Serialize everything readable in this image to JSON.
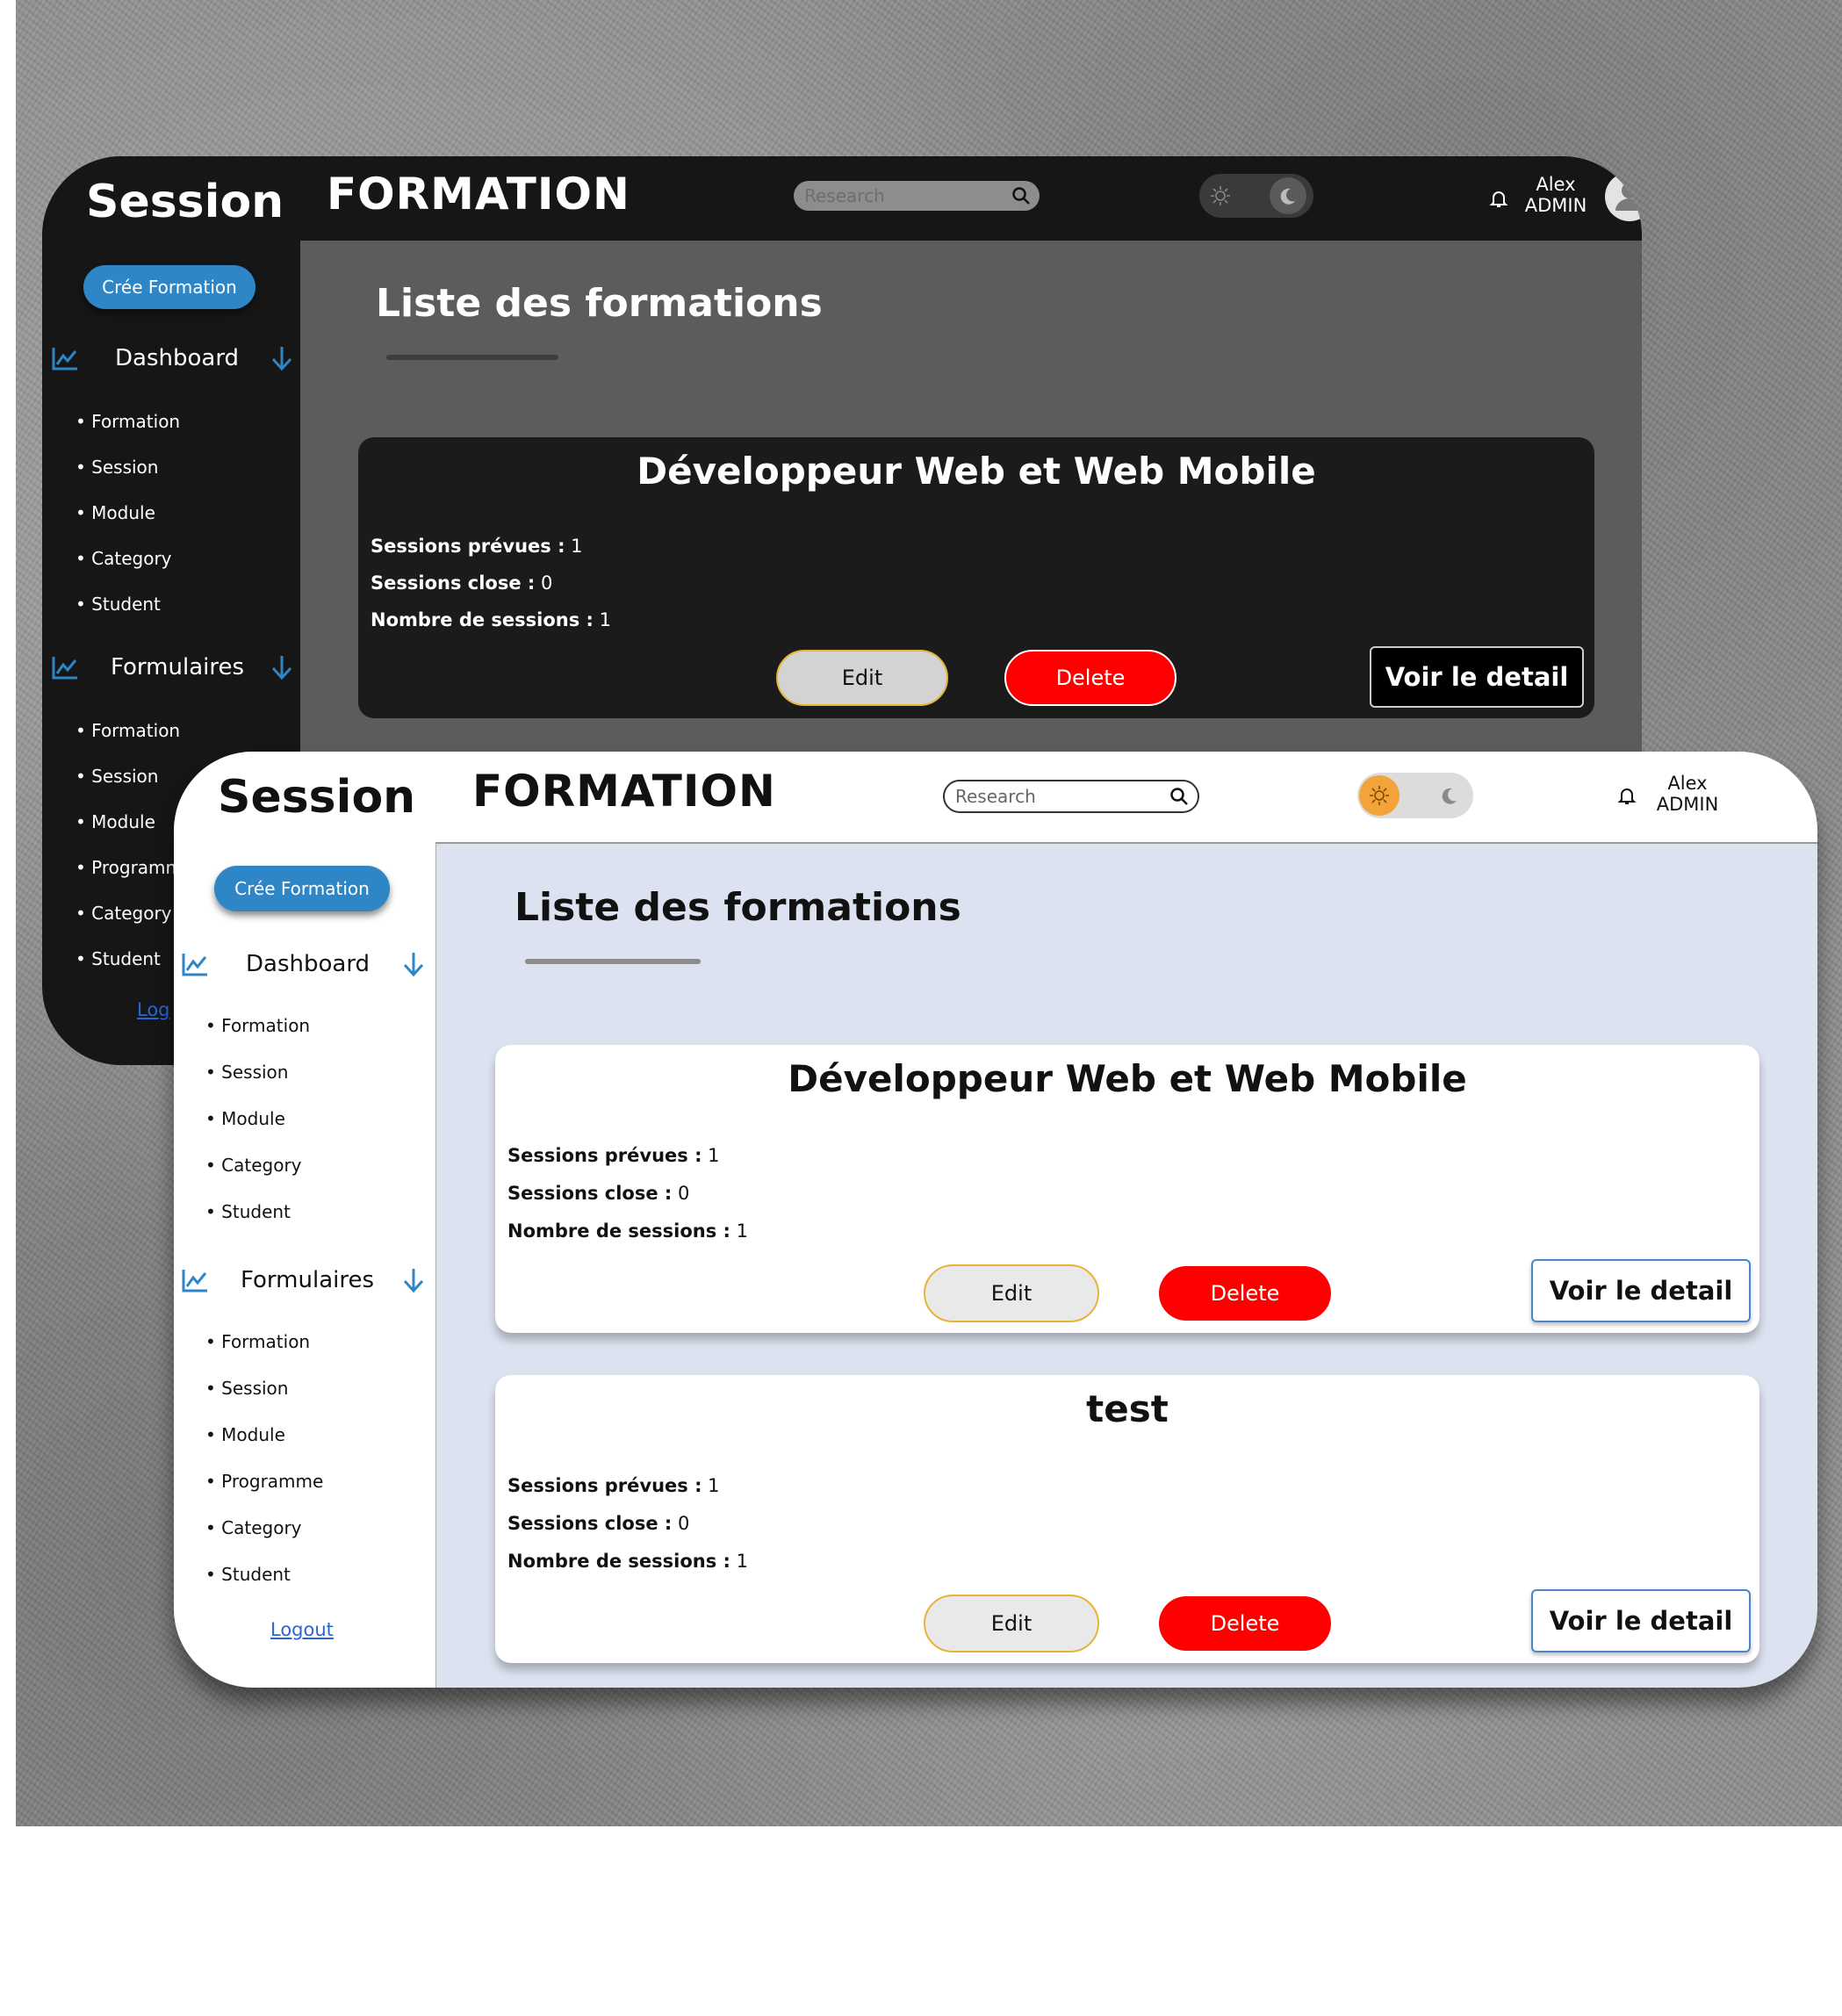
{
  "dark_window": {
    "brand": "Session",
    "create_button": "Crée Formation",
    "dashboard_label": "Dashboard",
    "dashboard_items": [
      "• Formation",
      "• Session",
      "• Module",
      "• Category",
      "• Student"
    ],
    "forms_label": "Formulaires",
    "forms_items": [
      "• Formation",
      "• Session",
      "• Module",
      "• Programm",
      "• Category",
      "• Student"
    ],
    "logout": "Log",
    "app_title": "FORMATION",
    "search_placeholder": "Research",
    "user": {
      "name": "Alex",
      "role": "ADMIN"
    },
    "page_heading": "Liste des formations",
    "cards": [
      {
        "title": "Développeur Web et Web Mobile",
        "stats": [
          {
            "label": "Sessions prévues :",
            "value": "1"
          },
          {
            "label": "Sessions close :",
            "value": "0"
          },
          {
            "label": "Nombre de sessions :",
            "value": "1"
          }
        ],
        "edit": "Edit",
        "delete": "Delete",
        "detail": "Voir le detail"
      }
    ]
  },
  "light_window": {
    "brand": "Session",
    "create_button": "Crée Formation",
    "dashboard_label": "Dashboard",
    "dashboard_items": [
      "• Formation",
      "• Session",
      "• Module",
      "• Category",
      "• Student"
    ],
    "forms_label": "Formulaires",
    "forms_items": [
      "• Formation",
      "• Session",
      "• Module",
      "• Programme",
      "• Category",
      "• Student"
    ],
    "logout": "Logout",
    "app_title": "FORMATION",
    "search_placeholder": "Research",
    "user": {
      "name": "Alex",
      "role": "ADMIN"
    },
    "page_heading": "Liste des formations",
    "cards": [
      {
        "title": "Développeur Web et Web Mobile",
        "stats": [
          {
            "label": "Sessions prévues :",
            "value": "1"
          },
          {
            "label": "Sessions close :",
            "value": "0"
          },
          {
            "label": "Nombre de sessions :",
            "value": "1"
          }
        ],
        "edit": "Edit",
        "delete": "Delete",
        "detail": "Voir le detail"
      },
      {
        "title": "test",
        "stats": [
          {
            "label": "Sessions prévues :",
            "value": "1"
          },
          {
            "label": "Sessions close :",
            "value": "0"
          },
          {
            "label": "Nombre de sessions :",
            "value": "1"
          }
        ],
        "edit": "Edit",
        "delete": "Delete",
        "detail": "Voir le detail"
      }
    ]
  },
  "colors": {
    "accent_blue": "#2f86c6",
    "delete_red": "#ff0000",
    "edit_border": "#e8b33a",
    "sun_orange": "#f2a33a"
  },
  "icons": [
    "chart-line-icon",
    "arrow-down-icon",
    "search-icon",
    "sun-icon",
    "moon-icon",
    "bell-icon",
    "user-avatar-icon"
  ]
}
